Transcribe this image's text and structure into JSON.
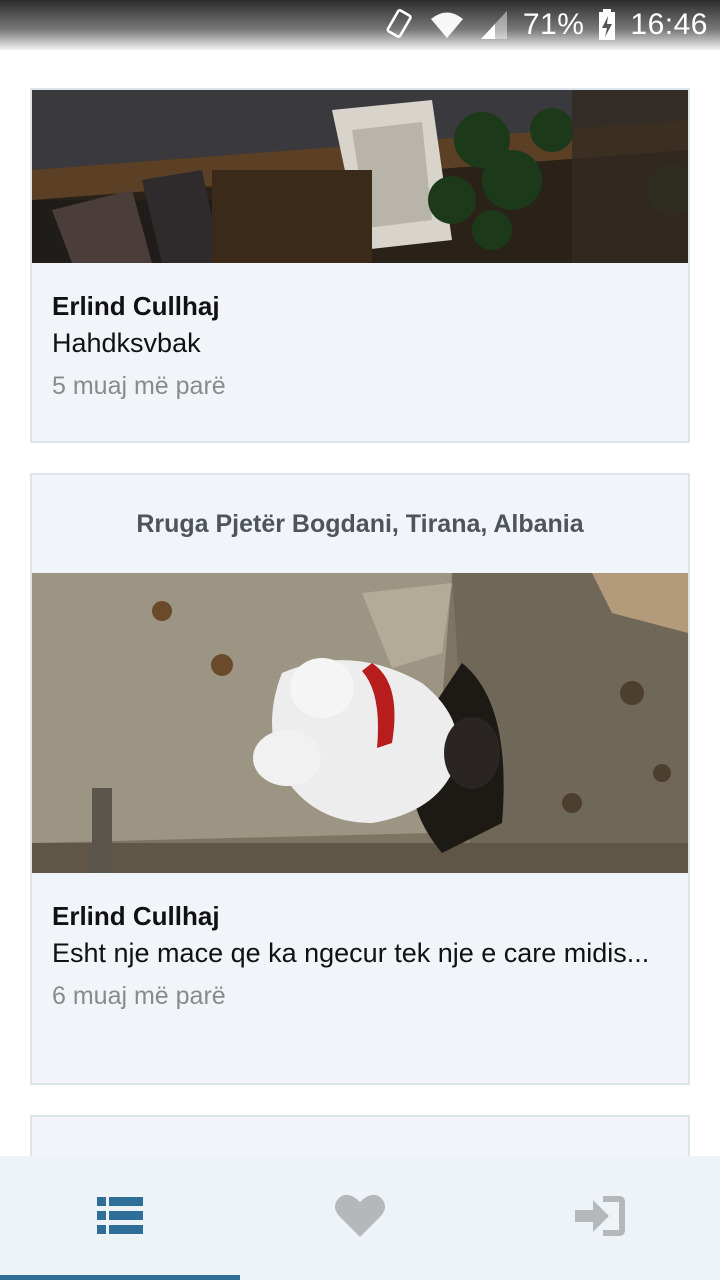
{
  "status_bar": {
    "battery": "71%",
    "time": "16:46",
    "icons": [
      "screen-rotation-icon",
      "wifi-icon",
      "signal-icon",
      "battery-charging-icon"
    ]
  },
  "feed": {
    "posts": [
      {
        "location": "",
        "author": "Erlind Cullhaj",
        "text": "Hahdksvbak",
        "time": "5 muaj më parë"
      },
      {
        "location": "Rruga Pjetër Bogdani, Tirana, Albania",
        "author": "Erlind Cullhaj",
        "text": "Esht nje mace qe ka ngecur tek nje e care midis...",
        "time": "6 muaj më parë"
      }
    ]
  },
  "bottom_nav": {
    "tabs": [
      {
        "icon": "list-icon",
        "active": true
      },
      {
        "icon": "heart-icon",
        "active": false
      },
      {
        "icon": "login-icon",
        "active": false
      }
    ],
    "colors": {
      "active": "#2e6e98",
      "inactive": "#b5b8bb",
      "background": "#eef3f8"
    }
  }
}
